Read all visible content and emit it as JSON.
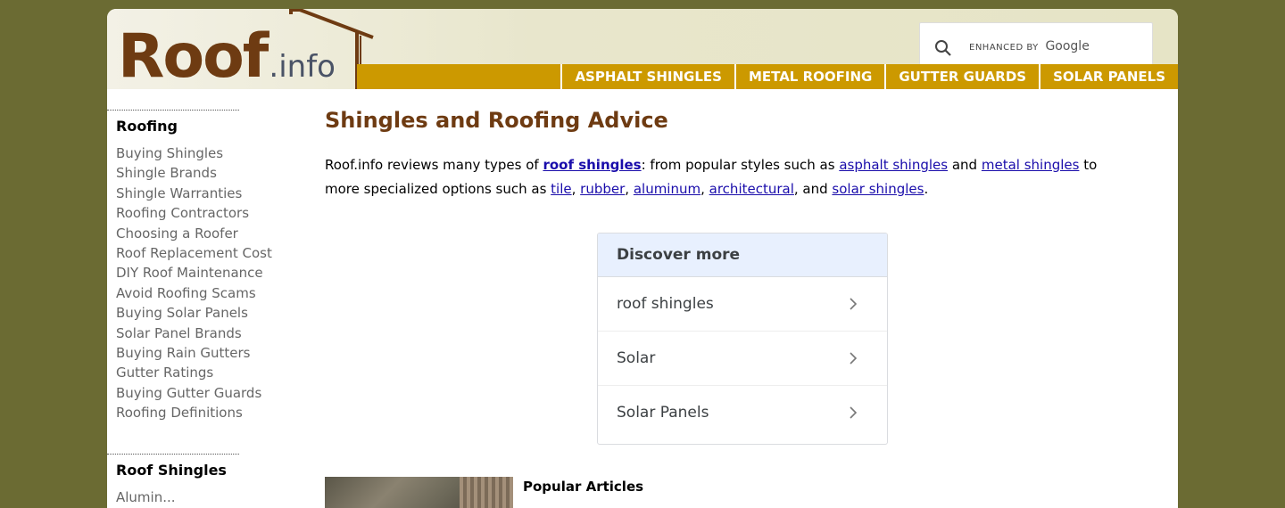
{
  "logo": {
    "brand": "Roof",
    "suffix": ".info"
  },
  "search": {
    "brand_label": "ENHANCED BY",
    "google_label": "Google"
  },
  "nav": {
    "items": [
      {
        "label": "ASPHALT SHINGLES"
      },
      {
        "label": "METAL ROOFING"
      },
      {
        "label": "GUTTER GUARDS"
      },
      {
        "label": "SOLAR PANELS"
      }
    ]
  },
  "sidebar": {
    "sections": [
      {
        "title": "Roofing",
        "links": [
          "Buying Shingles",
          "Shingle Brands",
          "Shingle Warranties",
          "Roofing Contractors",
          "Choosing a Roofer",
          "Roof Replacement Cost",
          "DIY Roof Maintenance",
          "Avoid Roofing Scams",
          "Buying Solar Panels",
          "Solar Panel Brands",
          "Buying Rain Gutters",
          "Gutter Ratings",
          "Buying Gutter Guards",
          "Roofing Definitions"
        ]
      },
      {
        "title": "Roof Shingles",
        "links": [
          "Alumin..."
        ]
      }
    ]
  },
  "main": {
    "title": "Shingles and Roofing Advice",
    "intro": {
      "t1": "Roof.info reviews many types of ",
      "l1": "roof shingles",
      "t2": ": from popular styles such as ",
      "l2": "asphalt shingles",
      "t3": " and ",
      "l3": "metal shingles",
      "t4": " to more specialized options such as ",
      "l4": "tile",
      "t5": ", ",
      "l5": "rubber",
      "t6": ", ",
      "l6": "aluminum",
      "t7": ", ",
      "l7": "architectural",
      "t8": ", and ",
      "l8": "solar shingles",
      "t9": "."
    },
    "discover": {
      "heading": "Discover more",
      "items": [
        {
          "label": "roof shingles"
        },
        {
          "label": "Solar"
        },
        {
          "label": "Solar Panels"
        }
      ]
    },
    "popular": {
      "title": "Popular Articles"
    }
  },
  "colors": {
    "background": "#6b6b33",
    "brand_brown": "#6e3b12",
    "nav_gold": "#cc9900",
    "link_blue": "#1a0dab"
  },
  "icons": {
    "search": "search-icon",
    "chevron": "chevron-right-icon"
  }
}
